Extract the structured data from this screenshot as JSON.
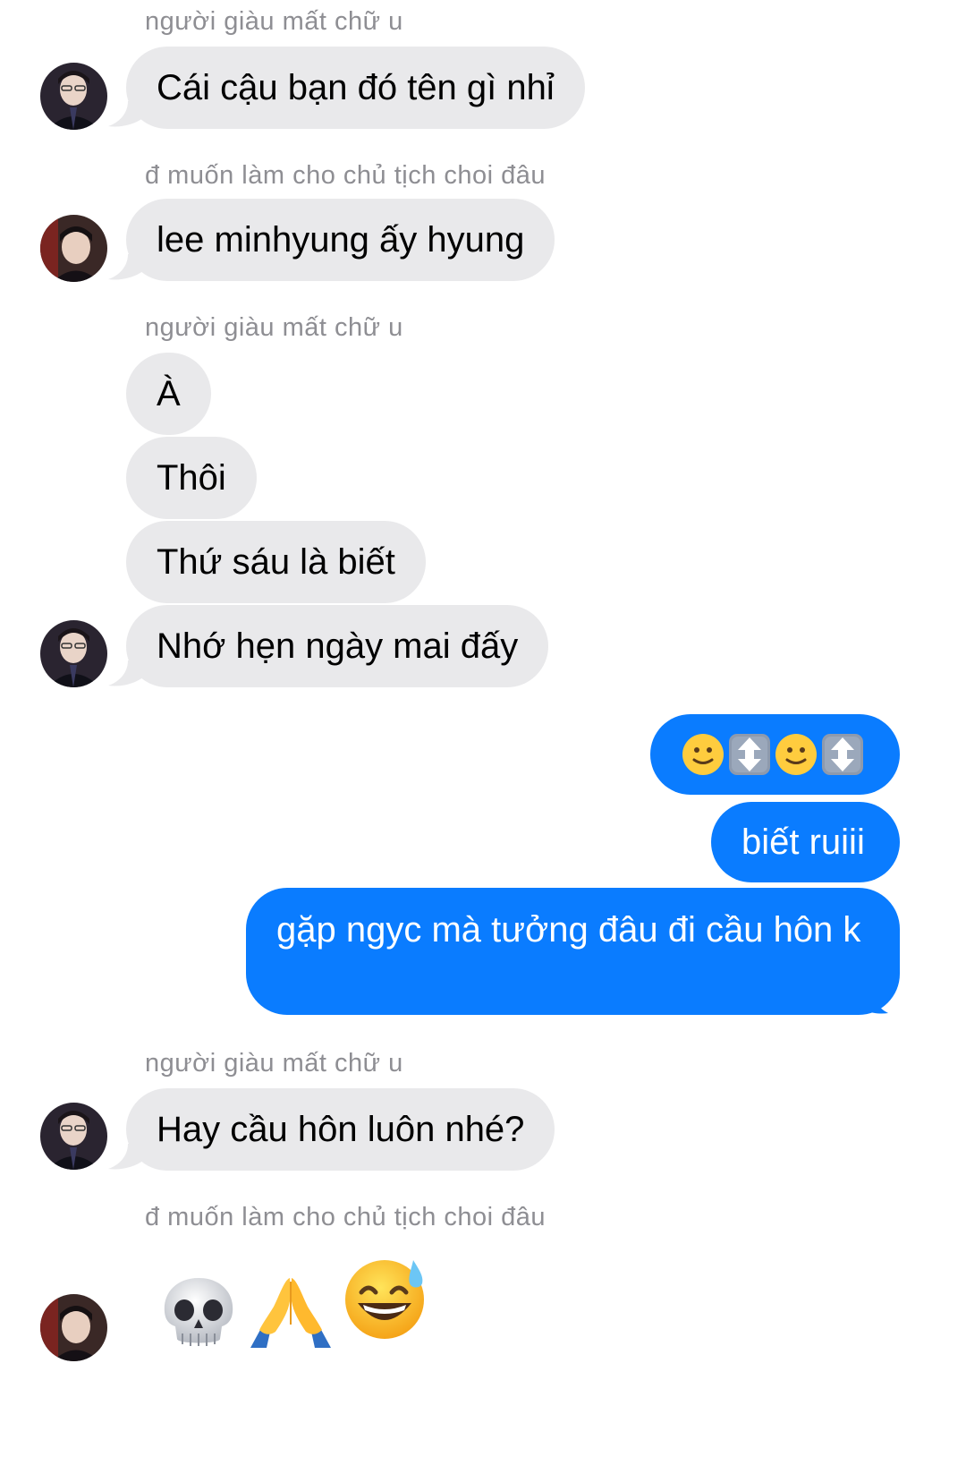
{
  "conversation": [
    {
      "sender": "người giàu mất chữ u",
      "messages": [
        "Cái cậu bạn đó tên gì nhỉ"
      ]
    },
    {
      "sender": "đ muốn làm cho chủ tịch choi đâu",
      "messages": [
        "lee minhyung ấy hyung"
      ]
    },
    {
      "sender": "người giàu mất chữ u",
      "messages": [
        "À",
        "Thôi",
        "Thứ sáu là biết",
        "Nhớ hẹn ngày mai đấy"
      ]
    },
    {
      "outgoing": [
        "🙂↕️🙂↕️",
        "biết ruiii",
        "gặp ngyc mà tưởng đâu đi cầu hôn k"
      ]
    },
    {
      "sender": "người giàu mất chữ u",
      "messages": [
        "Hay cầu hôn luôn nhé?"
      ]
    },
    {
      "sender": "đ muốn làm cho chủ tịch choi đâu",
      "messages": [
        "💀🙏😅"
      ]
    }
  ],
  "colors": {
    "incoming_bubble": "#e9e9eb",
    "outgoing_bubble": "#0a7cff",
    "sender_label": "#8e8e93"
  },
  "icons": {
    "avatar": "profile-photo",
    "reaction_1": "skull-emoji",
    "reaction_2": "folded-hands-emoji",
    "reaction_3": "grinning-sweat-emoji",
    "nod": "slightly-smiling-face-with-up-down-arrow"
  }
}
